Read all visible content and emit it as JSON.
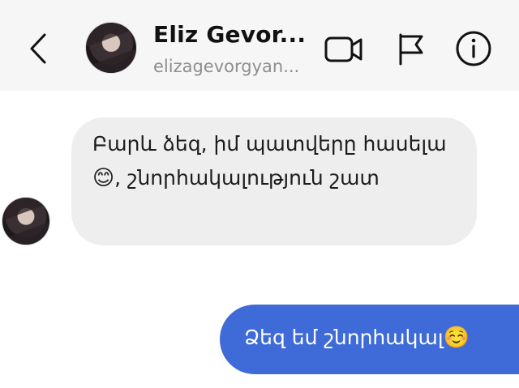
{
  "header": {
    "title": "Eliz Gevor...",
    "username": "elizagevorgyan...",
    "icons": {
      "back": "chevron-left-icon",
      "video": "video-camera-icon",
      "flag": "flag-icon",
      "info": "info-icon"
    }
  },
  "messages": [
    {
      "direction": "incoming",
      "text_part1": "Բարև ձեզ, իմ պատվերը հասելա ",
      "emoji": "😊",
      "text_part2": ", շնորհակալություն շատ"
    },
    {
      "direction": "outgoing",
      "text": "Ձեզ եմ շնորհակալ",
      "emoji": "☺️"
    }
  ],
  "colors": {
    "header_bg": "#f6f6f6",
    "incoming_bubble": "#eeeeee",
    "outgoing_bubble": "#3f6bd8",
    "subtitle": "#8e8e8e"
  }
}
